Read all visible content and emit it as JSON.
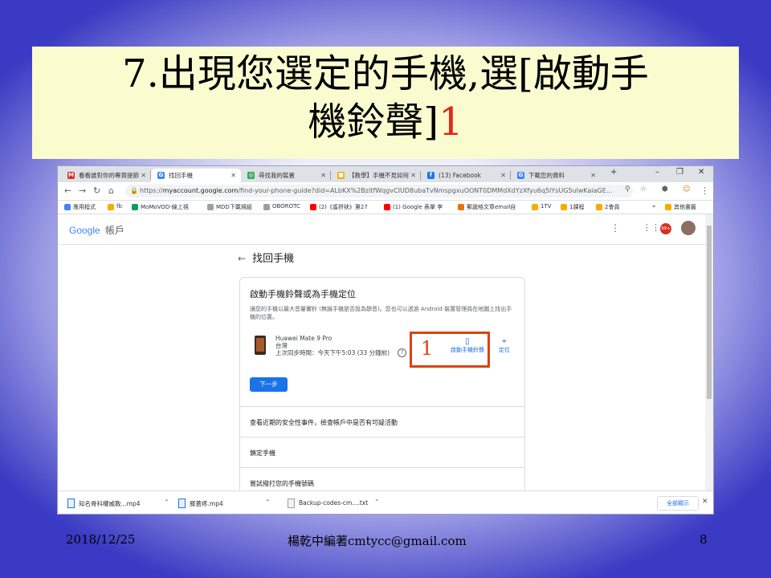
{
  "slide": {
    "title_line1": "7.出現您選定的手機,選[啟動手",
    "title_line2": "機鈴聲]",
    "title_mark": "1",
    "date": "2018/12/25",
    "author": "楊乾中編著cmtycc@gmail.com",
    "page_number": "8"
  },
  "browser": {
    "tabs": [
      {
        "label": "看看誰對你的專買提節",
        "icon": "gmail-icon",
        "color": "#d93025",
        "glyph": "M"
      },
      {
        "label": "找回手機",
        "icon": "google-icon",
        "color": "#4285f4",
        "glyph": "G",
        "active": true
      },
      {
        "label": "尋找我的裝置",
        "icon": "find-device-icon",
        "color": "#34a853",
        "glyph": "◎"
      },
      {
        "label": "【教學】手機不見如何",
        "icon": "blog-icon",
        "color": "#f9ab00",
        "glyph": "■"
      },
      {
        "label": "(13) Facebook",
        "icon": "facebook-icon",
        "color": "#1877f2",
        "glyph": "f"
      },
      {
        "label": "下載您的資料",
        "icon": "google-icon",
        "color": "#4285f4",
        "glyph": "G"
      }
    ],
    "new_tab": "+",
    "window_controls": [
      "–",
      "❐",
      "✕"
    ],
    "url_prefix": "https://",
    "url_host": "myaccount.google.com",
    "url_path": "/find-your-phone-guide?did=ALbKX%2BzitfWqgvCIUD8ubaTvNmspgxuOONT0DMMdXdYzXfyu6q5lYsUG5ulwKaiaGE...",
    "bookmarks": [
      {
        "label": "應用程式",
        "color": "#4285f4"
      },
      {
        "label": "fb",
        "color": "#f9ab00"
      },
      {
        "label": "MoMoVOD-線上視",
        "color": "#0f9d58"
      },
      {
        "label": "MDD下載規組",
        "color": "#9aa0a6"
      },
      {
        "label": "OBOROTC",
        "color": "#9aa0a6"
      },
      {
        "label": "(2)《遙拼袂》第27",
        "color": "#ff0000"
      },
      {
        "label": "(1) Google 表單 李",
        "color": "#ff0000"
      },
      {
        "label": "郵遞格文章email自",
        "color": "#e8710a"
      },
      {
        "label": "1TV",
        "color": "#f9ab00"
      },
      {
        "label": "1課程",
        "color": "#f9ab00"
      },
      {
        "label": "2會員",
        "color": "#f9ab00"
      }
    ],
    "bookmarks_more": "»",
    "bookmarks_other": "其他書籤"
  },
  "page": {
    "logo_google": "Google",
    "logo_account": "帳戶",
    "back_title": "找回手機",
    "card_title": "啟動手機鈴聲或為手機定位",
    "card_desc": "讓您的手機以最大音量響鈴 (無論手機是否設為靜音)。您也可以透過 Android 裝置管理員在地圖上找出手機的位置。",
    "device_name": "Huawei Mate 9 Pro",
    "device_region": "台灣",
    "device_sync": "上次同步時間：今天下午5:03 (33 分鐘前)",
    "help": "?",
    "ring_label": "啟動手機鈴聲",
    "locate_label": "定位",
    "next_button": "下一步",
    "rows": [
      "查看近期的安全性事件，檢查帳戶中是否有可疑活動",
      "鎖定手機",
      "嘗試撥打您的手機號碼"
    ],
    "annotation": "1",
    "avatar_badge": "99+"
  },
  "downloads": {
    "items": [
      "知名骨科權威教...mp4",
      "膝蓋疼.mp4",
      "Backup-codes-cm....txt"
    ],
    "show_all": "全部顯示"
  }
}
